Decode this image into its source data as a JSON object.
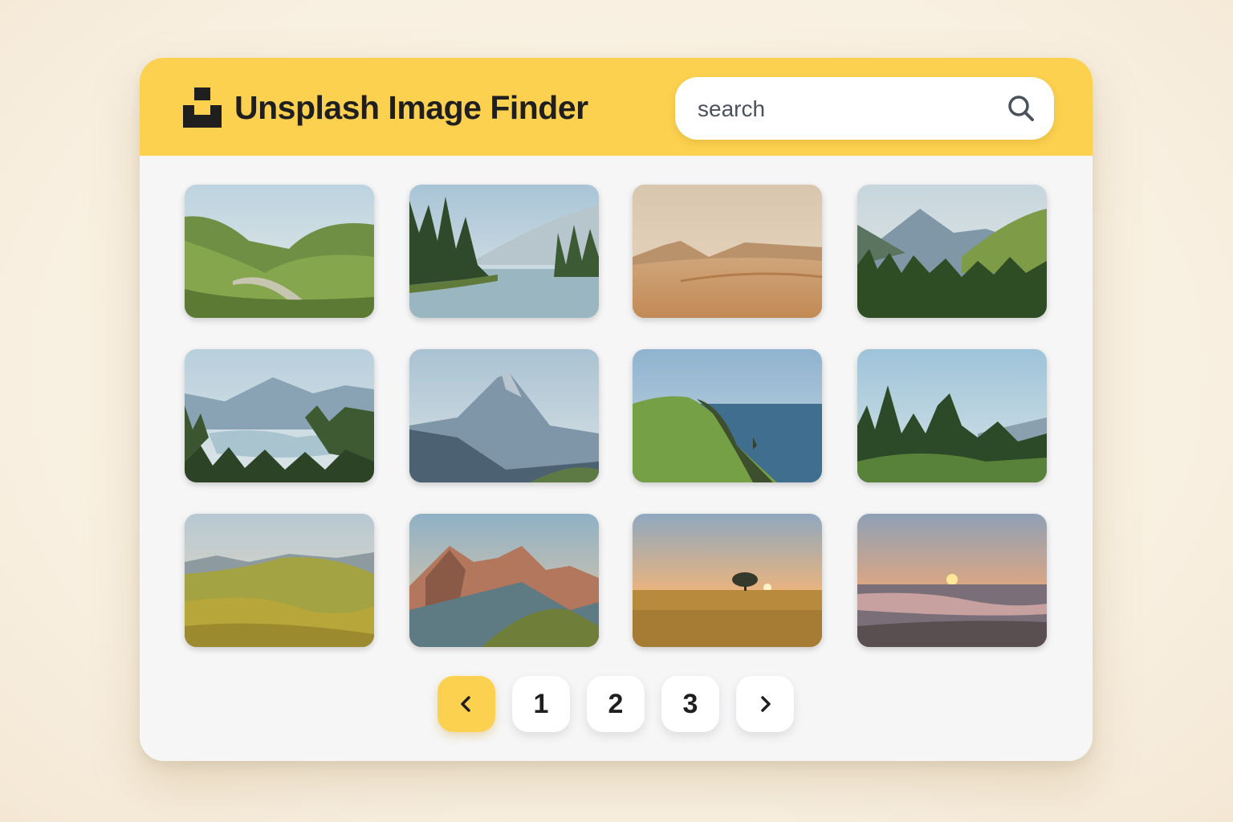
{
  "header": {
    "logo_icon": "unsplash-logo-icon",
    "title": "Unsplash Image Finder",
    "accent_color": "#fcd14f"
  },
  "search": {
    "placeholder": "search",
    "value": "",
    "icon": "search-icon"
  },
  "gallery": {
    "images": [
      {
        "subject": "green-valley-road"
      },
      {
        "subject": "misty-forest-lake"
      },
      {
        "subject": "desert-dunes"
      },
      {
        "subject": "mountain-pine-forest"
      },
      {
        "subject": "mountain-lake-forest"
      },
      {
        "subject": "misty-mountain-peak"
      },
      {
        "subject": "sea-cliff"
      },
      {
        "subject": "pine-trees-hillside"
      },
      {
        "subject": "golden-rolling-hills"
      },
      {
        "subject": "rocky-mountain-ridge"
      },
      {
        "subject": "sunset-field-tree"
      },
      {
        "subject": "beach-sunset"
      }
    ]
  },
  "pagination": {
    "prev_icon": "chevron-left-icon",
    "next_icon": "chevron-right-icon",
    "pages": [
      "1",
      "2",
      "3"
    ],
    "active": "prev"
  }
}
